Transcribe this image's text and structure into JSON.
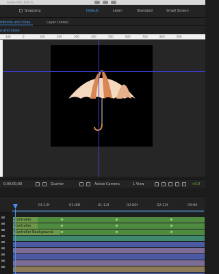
{
  "window": {
    "title": "Adobe After Effects"
  },
  "toolbar": {
    "snapping_label": "Snapping",
    "workspaces": [
      "Default",
      "Learn",
      "Standard",
      "Small Screen"
    ],
    "active_workspace": "Default"
  },
  "panel_tabs": {
    "composition_tab": "mbrella and close",
    "layer_tab": "Layer (none)",
    "sub_tab": "a and close"
  },
  "ruler": {
    "labels": [
      "100",
      "0",
      "100",
      "200",
      "300",
      "400",
      "500",
      "600",
      "700",
      "800",
      "900"
    ]
  },
  "viewer_controls": {
    "timecode": "0;00;00;00",
    "resolution": "Quarter",
    "camera": "Active Camera",
    "views": "1 View",
    "offset": "+0.0"
  },
  "timeline": {
    "time_labels": [
      "01:12f",
      "01:00f",
      "01:12f",
      "02:00f",
      "02:12f",
      "03:00"
    ],
    "layers": [
      {
        "name": "Controller",
        "color": "#4f8a41"
      },
      {
        "name": "Controller",
        "color": "#4f8a41"
      },
      {
        "name": "Controller Background",
        "color": "#4f8a41"
      },
      {
        "name": "",
        "color": "#3f8a6e"
      },
      {
        "name": "",
        "color": "#4c5aa3"
      },
      {
        "name": "",
        "color": "#7c6d96"
      },
      {
        "name": "",
        "color": "#4c5aa3"
      },
      {
        "name": "",
        "color": "#7c6d96"
      },
      {
        "name": "",
        "color": "#8c7a57"
      },
      {
        "name": "",
        "color": "#4c5aa3"
      }
    ]
  },
  "colors": {
    "accent": "#4d9df5",
    "guides": "#3b3fd9",
    "umbrella_light": "#f5d9bf",
    "umbrella_dark": "#d98655",
    "handle": "#d08c4a"
  }
}
